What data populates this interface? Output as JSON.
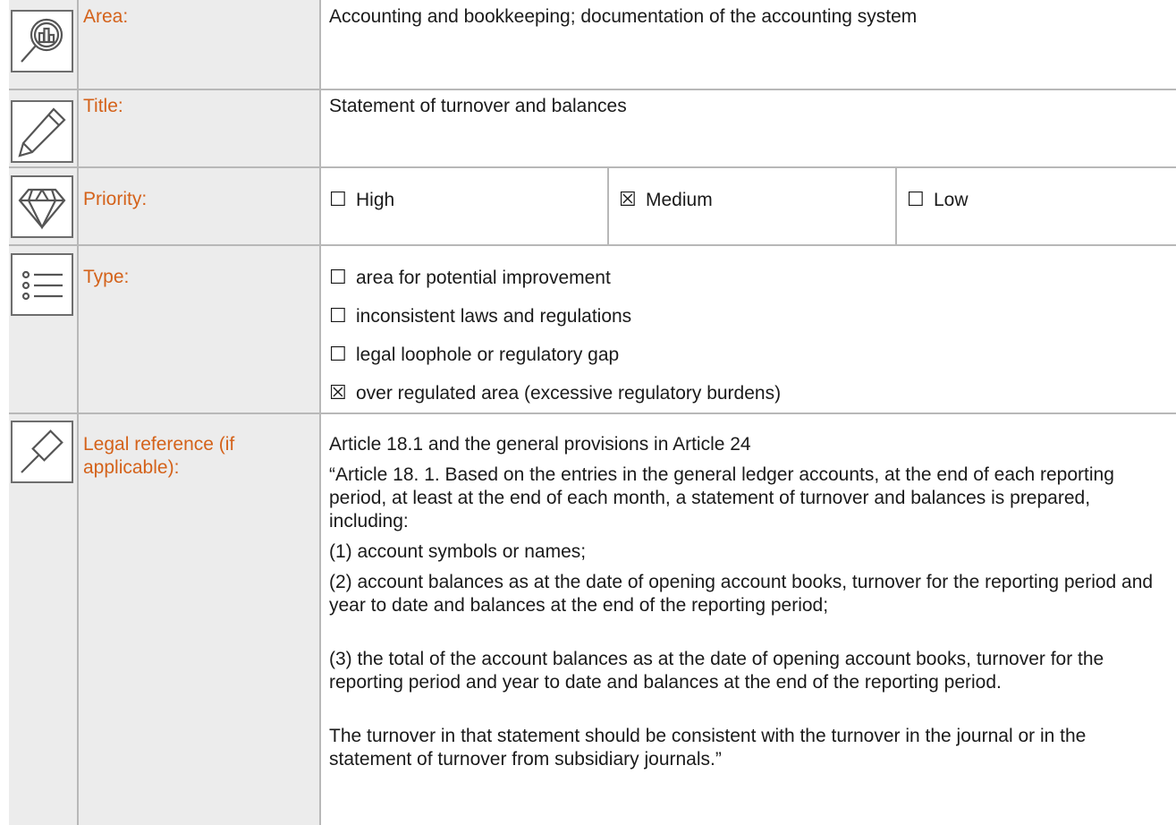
{
  "rows": {
    "area": {
      "label": "Area:",
      "value": "Accounting and bookkeeping; documentation of the accounting system"
    },
    "title": {
      "label": "Title:",
      "value": "Statement of turnover and balances"
    },
    "priority": {
      "label": "Priority:",
      "options": [
        {
          "box": "☐",
          "text": "High"
        },
        {
          "box": "☒",
          "text": "Medium"
        },
        {
          "box": "☐",
          "text": "Low"
        }
      ]
    },
    "type": {
      "label": "Type:",
      "options": [
        {
          "box": "☐",
          "text": "area for potential improvement"
        },
        {
          "box": "☐",
          "text": "inconsistent laws and regulations"
        },
        {
          "box": "☐",
          "text": "legal loophole or regulatory gap"
        },
        {
          "box": "☒",
          "text": "over regulated area (excessive regulatory burdens)"
        }
      ]
    },
    "legal": {
      "label": "Legal reference (if applicable):",
      "paragraphs": [
        "Article 18.1 and the general provisions in Article 24",
        "“Article 18. 1. Based on the entries in the general ledger accounts, at the end of each reporting period, at least at the end of each month, a statement of turnover and balances is prepared, including:",
        "(1) account symbols or names;",
        "(2) account balances as at the date of opening account books, turnover for the reporting period and year to date and balances at the end of the reporting period;",
        "(3) the total of the account balances as at the date of opening account books, turnover for the reporting period and year to date and balances at the end of the reporting period.",
        "The turnover in that statement should be consistent with the turnover in the journal or in the statement of turnover from subsidiary journals.”"
      ]
    }
  },
  "icons": [
    "magnifier-chart-icon",
    "pencil-icon",
    "diamond-icon",
    "list-icon",
    "gavel-icon"
  ],
  "colors": {
    "label": "#d4621a",
    "grid": "#b8b8b8",
    "shade": "#ececec"
  }
}
